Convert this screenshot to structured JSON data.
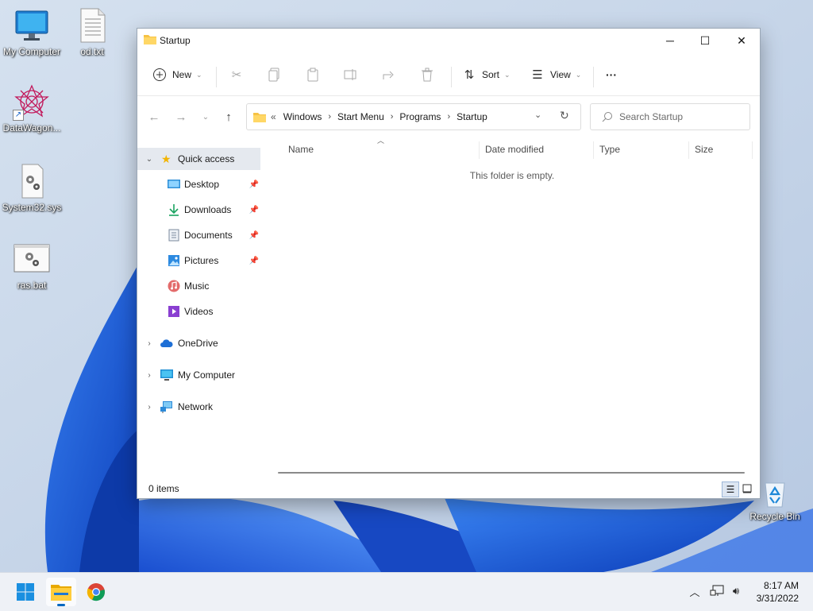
{
  "desktop": {
    "icons": [
      {
        "label": "My Computer",
        "icon": "monitor-icon"
      },
      {
        "label": "od.txt",
        "icon": "text-file-icon"
      },
      {
        "label": "DataWagon...",
        "icon": "app-shortcut-icon"
      },
      {
        "label": "System32.sys",
        "icon": "system-file-icon"
      },
      {
        "label": "ras.bat",
        "icon": "batch-file-icon"
      },
      {
        "label": "Recycle Bin",
        "icon": "recycle-bin-icon"
      }
    ]
  },
  "window": {
    "title": "Startup",
    "controls": {
      "minimize": "─",
      "maximize": "☐",
      "close": "✕"
    }
  },
  "toolbar": {
    "new_label": "New",
    "sort_label": "Sort",
    "view_label": "View",
    "more_label": "···"
  },
  "address": {
    "overflow": "«",
    "crumbs": [
      "Windows",
      "Start Menu",
      "Programs",
      "Startup"
    ]
  },
  "search": {
    "placeholder": "Search Startup"
  },
  "sidebar": {
    "quick_access": "Quick access",
    "items": [
      {
        "label": "Desktop",
        "icon": "desktop-folder-icon",
        "pinned": true
      },
      {
        "label": "Downloads",
        "icon": "download-icon",
        "pinned": true
      },
      {
        "label": "Documents",
        "icon": "documents-icon",
        "pinned": true
      },
      {
        "label": "Pictures",
        "icon": "pictures-icon",
        "pinned": true
      },
      {
        "label": "Music",
        "icon": "music-icon",
        "pinned": false
      },
      {
        "label": "Videos",
        "icon": "videos-icon",
        "pinned": false
      }
    ],
    "roots": [
      {
        "label": "OneDrive",
        "icon": "cloud-icon"
      },
      {
        "label": "My Computer",
        "icon": "monitor-icon"
      },
      {
        "label": "Network",
        "icon": "network-icon"
      }
    ]
  },
  "content": {
    "columns": [
      "Name",
      "Date modified",
      "Type",
      "Size"
    ],
    "empty_message": "This folder is empty."
  },
  "status": {
    "items_count": "0 items"
  },
  "taskbar": {
    "apps": [
      "start-icon",
      "file-explorer-icon",
      "chrome-icon"
    ],
    "time": "8:17 AM",
    "date": "3/31/2022"
  },
  "colors": {
    "accent": "#0067c0",
    "folder": "#f6c244",
    "wallpaper_blue": "#1f5fd6"
  }
}
